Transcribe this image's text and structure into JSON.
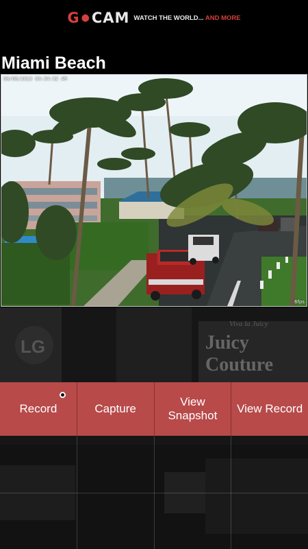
{
  "header": {
    "logo_g": "G",
    "logo_dot": "●",
    "logo_cam": "CAM",
    "tagline_main": "WATCH THE WORLD...",
    "tagline_accent": "AND MORE"
  },
  "camera": {
    "title": "Miami Beach",
    "timestamp": "08/08/2013 03:34:32 AM",
    "fps": "6fps"
  },
  "background_signs": {
    "lg": "LG",
    "juicy": "Juicy Couture",
    "juicy_sub": "Viva la Juicy"
  },
  "actions": [
    {
      "label": "Record"
    },
    {
      "label": "Capture"
    },
    {
      "label": "View Snapshot"
    },
    {
      "label": "View Record"
    }
  ],
  "colors": {
    "brand_red": "#d4413c",
    "button_bg": "#b84a4a"
  }
}
